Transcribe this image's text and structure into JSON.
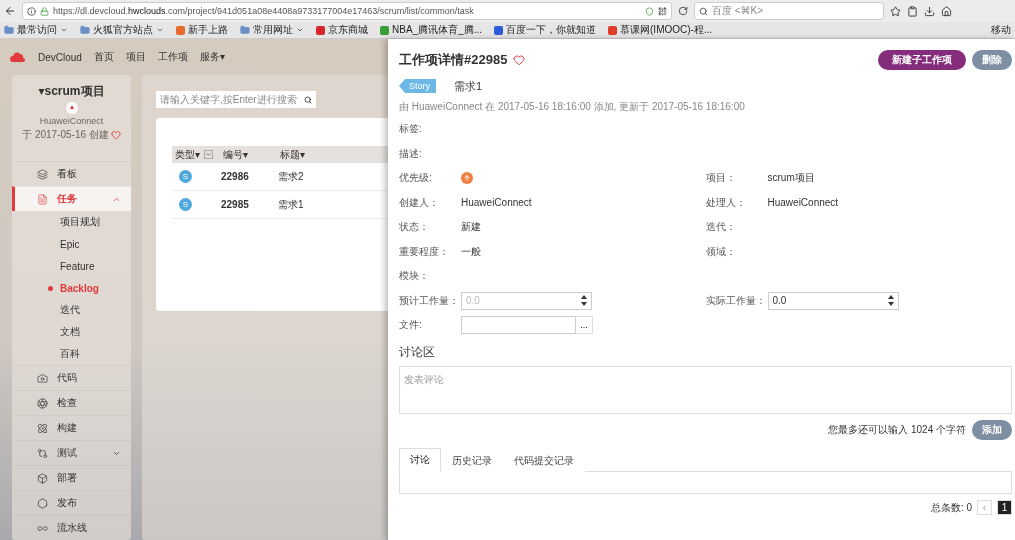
{
  "browser": {
    "url_prefix": "https://dl.devcloud.",
    "url_domain": "hwclouds",
    "url_rest": ".com/project/941d051a08e4408a9733177004e17463/scrum/list/common/task",
    "search_placeholder": "百度 <⌘K>",
    "bookmarks": [
      {
        "label": "最常访问",
        "kind": "folder",
        "dropdown": true,
        "color": "#6b8fc7"
      },
      {
        "label": "火狐官方站点",
        "kind": "folder",
        "dropdown": true,
        "color": "#6b8fc7"
      },
      {
        "label": "新手上路",
        "kind": "site",
        "dropdown": false,
        "color": "#e66b2a"
      },
      {
        "label": "常用网址",
        "kind": "folder",
        "dropdown": true,
        "color": "#6b8fc7"
      },
      {
        "label": "京东商城",
        "kind": "site",
        "dropdown": false,
        "color": "#d8262f"
      },
      {
        "label": "NBA_腾讯体育_腾...",
        "kind": "site",
        "dropdown": false,
        "color": "#3a9d3a"
      },
      {
        "label": "百度一下，你就知道",
        "kind": "site",
        "dropdown": false,
        "color": "#2d5cd8"
      },
      {
        "label": "慕课网(IMOOC)-程...",
        "kind": "site",
        "dropdown": false,
        "color": "#e23a2a"
      }
    ],
    "mobile_bookmarks": "移动"
  },
  "header": {
    "brand": "DevCloud",
    "nav": [
      "首页",
      "项目",
      "工作项",
      "服务▾"
    ]
  },
  "sidebar": {
    "project": "▾scrum项目",
    "owner": "HuaweiConnect",
    "created": "于 2017-05-16 创建",
    "items": [
      {
        "label": "看板",
        "kind": "item",
        "selected": false
      },
      {
        "label": "任务",
        "kind": "item",
        "selected": true,
        "expanded": true
      },
      {
        "label": "项目规划",
        "kind": "sub",
        "selected": false
      },
      {
        "label": "Epic",
        "kind": "sub",
        "selected": false
      },
      {
        "label": "Feature",
        "kind": "sub",
        "selected": false
      },
      {
        "label": "Backlog",
        "kind": "sub",
        "selected": true
      },
      {
        "label": "迭代",
        "kind": "sub",
        "selected": false
      },
      {
        "label": "文档",
        "kind": "sub",
        "selected": false
      },
      {
        "label": "百科",
        "kind": "sub",
        "selected": false
      },
      {
        "label": "代码",
        "kind": "item",
        "selected": false
      },
      {
        "label": "检查",
        "kind": "item",
        "selected": false
      },
      {
        "label": "构建",
        "kind": "item",
        "selected": false
      },
      {
        "label": "测试",
        "kind": "item",
        "selected": false,
        "expanded": false
      },
      {
        "label": "部署",
        "kind": "item",
        "selected": false
      },
      {
        "label": "发布",
        "kind": "item",
        "selected": false
      },
      {
        "label": "流水线",
        "kind": "item",
        "selected": false
      }
    ]
  },
  "list": {
    "search_placeholder": "请输入关键字,按Enter进行搜索",
    "columns": [
      {
        "label": "类型▾",
        "filter": true
      },
      {
        "label": "编号▾",
        "filter": false
      },
      {
        "label": "标题▾",
        "filter": false
      }
    ],
    "rows": [
      {
        "type": "S",
        "number": "22986",
        "title": "需求2"
      },
      {
        "type": "S",
        "number": "22985",
        "title": "需求1"
      }
    ]
  },
  "detail": {
    "title": "工作项详情#22985",
    "buttons": [
      {
        "label": "新建子工作项",
        "kind": "primary"
      },
      {
        "label": "删除",
        "kind": "secondary"
      }
    ],
    "tag": "Story",
    "name": "需求1",
    "meta": "由 HuaweiConnect 在 2017-05-16 18:16:00 添加, 更新于 2017-05-16 18:16:00",
    "rows": [
      [
        {
          "label": "标签:",
          "kind": "text"
        }
      ],
      [
        {
          "label": "描述:",
          "kind": "text"
        }
      ],
      [
        {
          "label": "优先级:",
          "kind": "priority"
        },
        {
          "label": "项目：",
          "kind": "text",
          "value": "scrum项目"
        }
      ],
      [
        {
          "label": "创建人：",
          "kind": "text",
          "value": "HuaweiConnect"
        },
        {
          "label": "处理人：",
          "kind": "text",
          "value": "HuaweiConnect"
        }
      ],
      [
        {
          "label": "状态：",
          "kind": "text",
          "value": "新建"
        },
        {
          "label": "迭代：",
          "kind": "text"
        }
      ],
      [
        {
          "label": "重要程度：",
          "kind": "text",
          "value": "一般"
        },
        {
          "label": "领域：",
          "kind": "text"
        }
      ],
      [
        {
          "label": "模块：",
          "kind": "text"
        }
      ],
      [
        {
          "label": "预计工作量：",
          "kind": "number",
          "placeholder": "0.0"
        },
        {
          "label": "实际工作量：",
          "kind": "number",
          "value": "0.0"
        }
      ],
      [
        {
          "label": "文件:",
          "kind": "file",
          "button": "..."
        }
      ]
    ],
    "discussion": {
      "heading": "讨论区",
      "placeholder": "发表评论",
      "counter": "您最多还可以输入 1024 个字符",
      "add_button": "添加",
      "tabs": [
        {
          "label": "讨论",
          "selected": true
        },
        {
          "label": "历史记录",
          "selected": false
        },
        {
          "label": "代码提交记录",
          "selected": false
        }
      ],
      "total": "总条数: 0",
      "prev": "‹",
      "pages": [
        {
          "label": "1",
          "selected": true
        }
      ]
    }
  }
}
